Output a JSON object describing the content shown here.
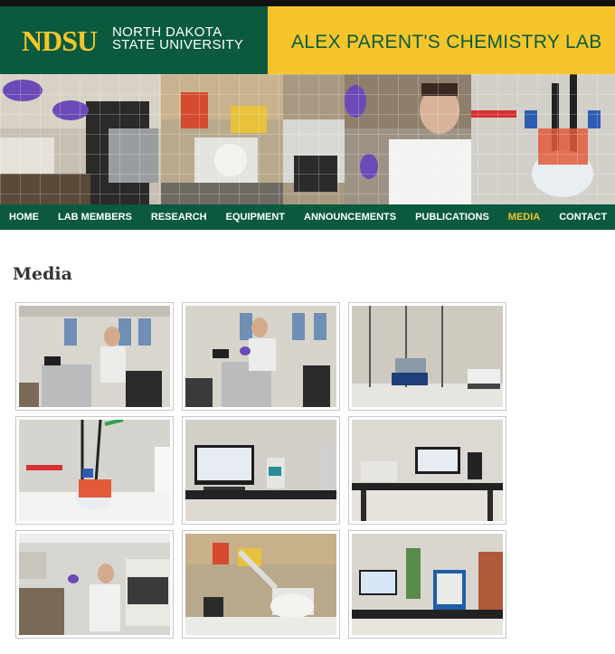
{
  "header": {
    "logo_abbrev": "NDSU",
    "logo_line1": "NORTH DAKOTA",
    "logo_line2": "STATE UNIVERSITY",
    "lab_title": "ALEX PARENT'S CHEMISTRY LAB"
  },
  "nav": {
    "items": [
      "HOME",
      "LAB MEMBERS",
      "RESEARCH",
      "EQUIPMENT",
      "ANNOUNCEMENTS",
      "PUBLICATIONS",
      "MEDIA",
      "CONTACT"
    ],
    "active": "MEDIA"
  },
  "page": {
    "title": "Media"
  },
  "gallery": {
    "rows": 3,
    "columns": 3,
    "photo_count": 9
  },
  "colors": {
    "brand_green": "#0b5a3e",
    "brand_gold": "#f5c52a"
  }
}
